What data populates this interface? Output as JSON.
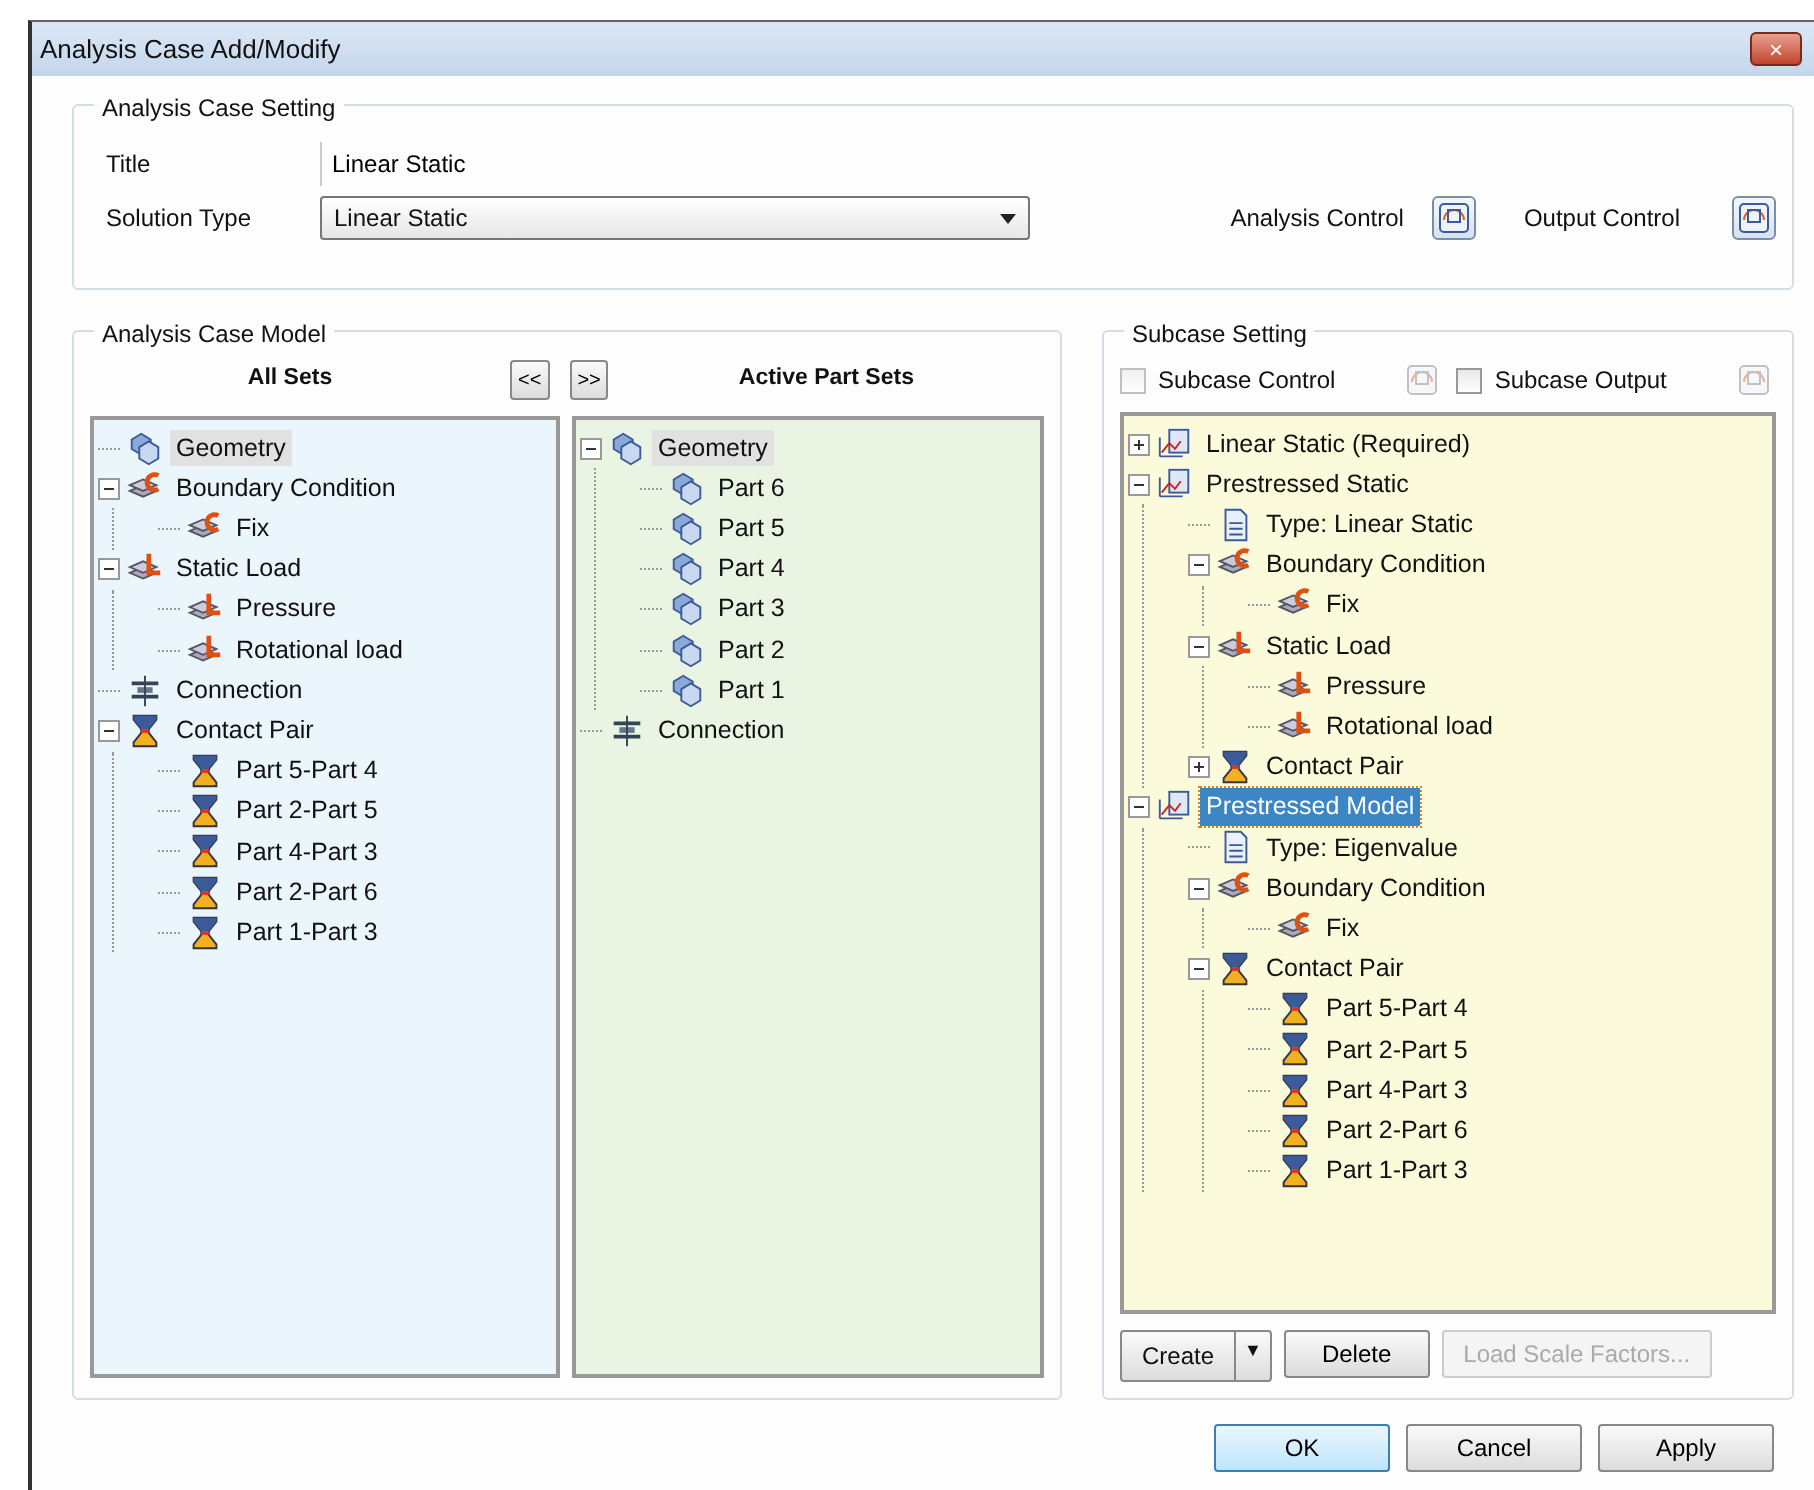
{
  "window": {
    "title": "Analysis Case Add/Modify",
    "close": "×"
  },
  "case_setting": {
    "legend": "Analysis Case Setting",
    "title_label": "Title",
    "title_value": "Linear Static",
    "solution_label": "Solution Type",
    "solution_value": "Linear Static",
    "analysis_control": "Analysis Control",
    "output_control": "Output Control"
  },
  "case_model": {
    "legend": "Analysis Case Model",
    "all_sets_label": "All Sets",
    "move_left": "<<",
    "move_right": ">>",
    "active_label": "Active Part Sets",
    "all_sets": {
      "focused": false,
      "items": [
        {
          "label": "Geometry",
          "kind": "geometry",
          "selected": true
        },
        {
          "label": "Boundary Condition",
          "kind": "bc",
          "selected": false,
          "expanded": true,
          "children": [
            {
              "label": "Fix",
              "kind": "bc",
              "selected": false
            }
          ]
        },
        {
          "label": "Static Load",
          "kind": "load",
          "selected": false,
          "expanded": true,
          "children": [
            {
              "label": "Pressure",
              "kind": "load",
              "selected": false
            },
            {
              "label": "Rotational load",
              "kind": "load",
              "selected": false
            }
          ]
        },
        {
          "label": "Connection",
          "kind": "connection",
          "selected": false
        },
        {
          "label": "Contact Pair",
          "kind": "contact",
          "selected": false,
          "expanded": true,
          "children": [
            {
              "label": "Part 5-Part 4",
              "kind": "contact",
              "selected": false
            },
            {
              "label": "Part 2-Part 5",
              "kind": "contact",
              "selected": false
            },
            {
              "label": "Part 4-Part 3",
              "kind": "contact",
              "selected": false
            },
            {
              "label": "Part 2-Part 6",
              "kind": "contact",
              "selected": false
            },
            {
              "label": "Part 1-Part 3",
              "kind": "contact",
              "selected": false
            }
          ]
        }
      ]
    },
    "active_sets": {
      "focused": false,
      "items": [
        {
          "label": "Geometry",
          "kind": "geometry",
          "selected": true,
          "expanded": true,
          "children": [
            {
              "label": "Part 6",
              "kind": "geometry",
              "selected": false
            },
            {
              "label": "Part 5",
              "kind": "geometry",
              "selected": false
            },
            {
              "label": "Part 4",
              "kind": "geometry",
              "selected": false
            },
            {
              "label": "Part 3",
              "kind": "geometry",
              "selected": false
            },
            {
              "label": "Part 2",
              "kind": "geometry",
              "selected": false
            },
            {
              "label": "Part 1",
              "kind": "geometry",
              "selected": false
            }
          ]
        },
        {
          "label": "Connection",
          "kind": "connection",
          "selected": false
        }
      ]
    }
  },
  "subcase": {
    "legend": "Subcase Setting",
    "subcase_control": {
      "label": "Subcase Control",
      "checked": false,
      "disabled": true
    },
    "subcase_output": {
      "label": "Subcase Output",
      "checked": false,
      "disabled": false
    },
    "tree": {
      "focused": true,
      "items": [
        {
          "label": "Linear Static (Required)",
          "kind": "case",
          "selected": false,
          "expanded": false
        },
        {
          "label": "Prestressed Static",
          "kind": "case",
          "selected": false,
          "expanded": true,
          "children": [
            {
              "label": "Type: Linear Static",
              "kind": "doc",
              "selected": false
            },
            {
              "label": "Boundary Condition",
              "kind": "bc",
              "selected": false,
              "expanded": true,
              "children": [
                {
                  "label": "Fix",
                  "kind": "bc",
                  "selected": false
                }
              ]
            },
            {
              "label": "Static Load",
              "kind": "load",
              "selected": false,
              "expanded": true,
              "children": [
                {
                  "label": "Pressure",
                  "kind": "load",
                  "selected": false
                },
                {
                  "label": "Rotational load",
                  "kind": "load",
                  "selected": false
                }
              ]
            },
            {
              "label": "Contact Pair",
              "kind": "contact",
              "selected": false,
              "expanded": false
            }
          ]
        },
        {
          "label": "Prestressed Model",
          "kind": "case",
          "selected": true,
          "expanded": true,
          "children": [
            {
              "label": "Type: Eigenvalue",
              "kind": "doc",
              "selected": false
            },
            {
              "label": "Boundary Condition",
              "kind": "bc",
              "selected": false,
              "expanded": true,
              "children": [
                {
                  "label": "Fix",
                  "kind": "bc",
                  "selected": false
                }
              ]
            },
            {
              "label": "Contact Pair",
              "kind": "contact",
              "selected": false,
              "expanded": true,
              "children": [
                {
                  "label": "Part 5-Part 4",
                  "kind": "contact",
                  "selected": false
                },
                {
                  "label": "Part 2-Part 5",
                  "kind": "contact",
                  "selected": false
                },
                {
                  "label": "Part 4-Part 3",
                  "kind": "contact",
                  "selected": false
                },
                {
                  "label": "Part 2-Part 6",
                  "kind": "contact",
                  "selected": false
                },
                {
                  "label": "Part 1-Part 3",
                  "kind": "contact",
                  "selected": false
                }
              ]
            }
          ]
        }
      ]
    },
    "create": "Create",
    "create_caret": "▼",
    "delete": "Delete",
    "load_scale": {
      "label": "Load Scale Factors...",
      "disabled": true
    }
  },
  "buttons": [
    {
      "label": "OK",
      "default": true
    },
    {
      "label": "Cancel",
      "default": false
    },
    {
      "label": "Apply",
      "default": false
    }
  ]
}
